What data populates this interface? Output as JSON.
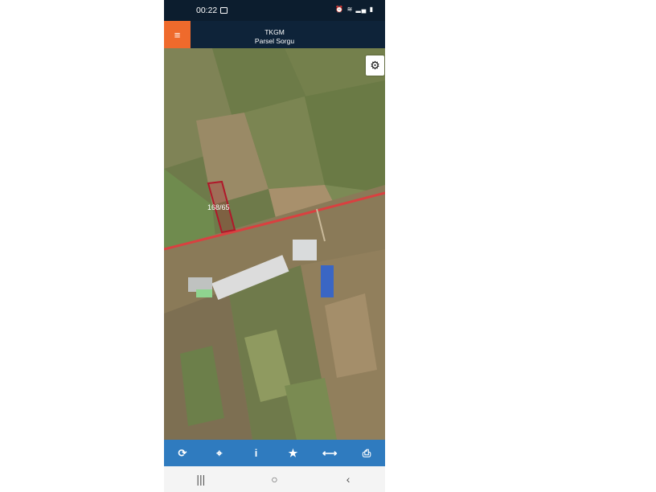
{
  "status_bar": {
    "time": "00:22",
    "icons": [
      "image-icon",
      "alarm-icon",
      "wifi-icon",
      "signal-icon",
      "battery-icon"
    ]
  },
  "header": {
    "title_line1": "TKGM",
    "title_line2": "Parsel Sorgu",
    "menu_icon": "hamburger-icon"
  },
  "map": {
    "parcel_label": "168/65",
    "settings_icon": "gear-icon"
  },
  "toolbar": {
    "buttons": [
      "refresh-icon",
      "locate-icon",
      "info-icon",
      "star-icon",
      "measure-icon",
      "print-icon"
    ]
  },
  "nav_bar": {
    "buttons": [
      "recent-apps",
      "home",
      "back"
    ]
  },
  "colors": {
    "accent": "#ef6a2c",
    "header": "#0e2339",
    "toolbar": "#2f7bbf",
    "road": "#d94040",
    "parcel": "#b0182a"
  }
}
